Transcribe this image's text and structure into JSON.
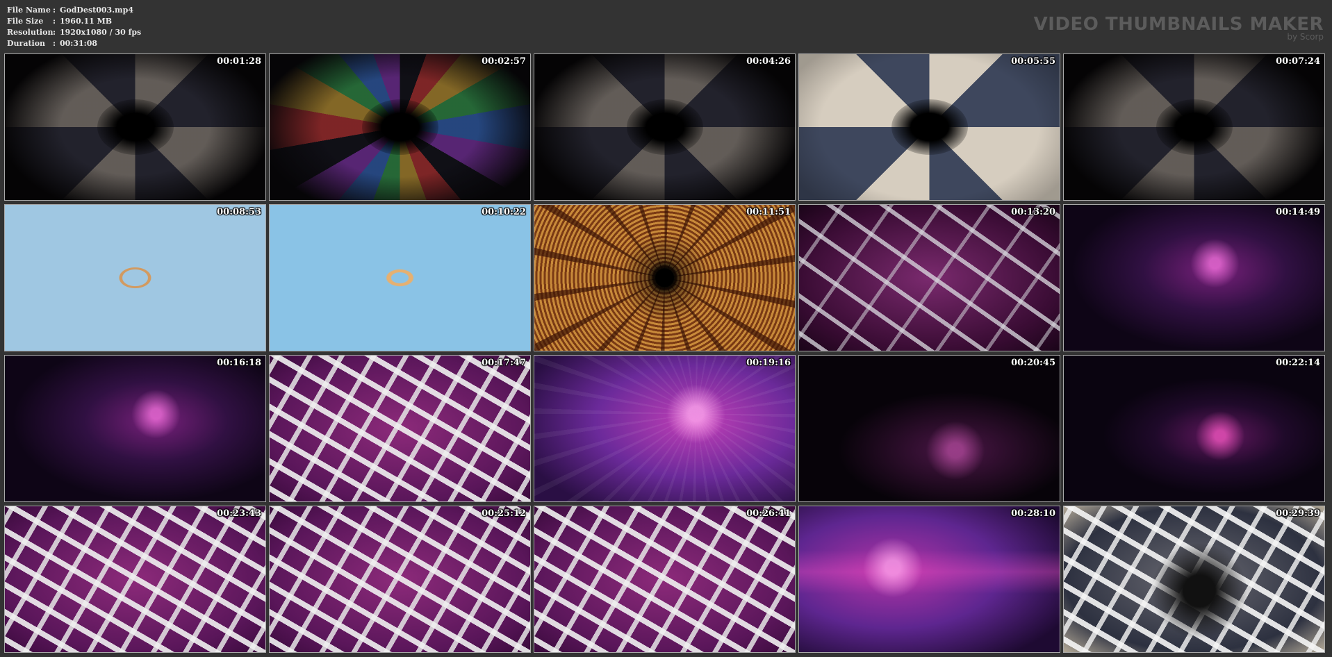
{
  "file_info": [
    {
      "key": "File Name",
      "value": "GodDest003.mp4"
    },
    {
      "key": "File Size",
      "value": "1960.11 MB"
    },
    {
      "key": "Resolution",
      "value": "1920x1080 / 30 fps"
    },
    {
      "key": "Duration",
      "value": "00:31:08"
    }
  ],
  "brand": {
    "title": "VIDEO THUMBNAILS MAKER",
    "subtitle": "by Scorp"
  },
  "thumbnails": [
    {
      "time": "00:01:28",
      "visual": "spiral-dark"
    },
    {
      "time": "00:02:57",
      "visual": "spiral-rainbow"
    },
    {
      "time": "00:04:26",
      "visual": "spiral-dark"
    },
    {
      "time": "00:05:55",
      "visual": "spiral-light"
    },
    {
      "time": "00:07:24",
      "visual": "spiral-dark"
    },
    {
      "time": "00:08:53",
      "visual": "ring-blue"
    },
    {
      "time": "00:10:22",
      "visual": "ring-gold"
    },
    {
      "time": "00:11:51",
      "visual": "tunnel-gold"
    },
    {
      "time": "00:13:20",
      "visual": "splash-purple"
    },
    {
      "time": "00:14:49",
      "visual": "nebula-mid"
    },
    {
      "time": "00:16:18",
      "visual": "nebula-mid"
    },
    {
      "time": "00:17:47",
      "visual": "splash-white"
    },
    {
      "time": "00:19:16",
      "visual": "nebula-bright"
    },
    {
      "time": "00:20:45",
      "visual": "nebula-dark"
    },
    {
      "time": "00:22:14",
      "visual": "nebula-dim"
    },
    {
      "time": "00:23:43",
      "visual": "splash-white"
    },
    {
      "time": "00:25:12",
      "visual": "splash-white"
    },
    {
      "time": "00:26:41",
      "visual": "splash-white"
    },
    {
      "time": "00:28:10",
      "visual": "nebula-wide"
    },
    {
      "time": "00:29:39",
      "visual": "splash-gray"
    }
  ]
}
